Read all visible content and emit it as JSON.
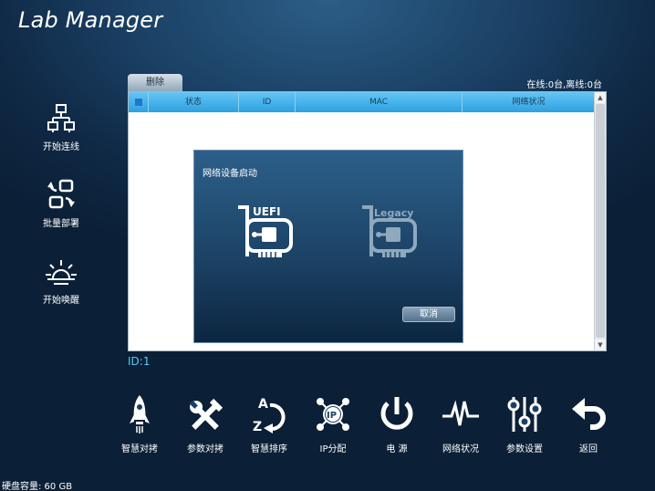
{
  "app": {
    "title": "Lab Manager"
  },
  "sidebar": {
    "items": [
      {
        "label": "开始连线",
        "icon": "network-icon"
      },
      {
        "label": "批量部署",
        "icon": "deploy-icon"
      },
      {
        "label": "开始唤醒",
        "icon": "sunrise-icon"
      }
    ]
  },
  "table": {
    "delete_label": "删除",
    "online_status": "在线:0台,离线:0台",
    "columns": [
      "状态",
      "ID",
      "MAC",
      "网络状况"
    ],
    "rows": []
  },
  "dialog": {
    "title": "网络设备启动",
    "options": [
      {
        "label": "UEFI",
        "icon": "uefi-card-icon",
        "state": "active"
      },
      {
        "label": "Legacy",
        "icon": "legacy-card-icon",
        "state": "dimmed"
      }
    ],
    "cancel_label": "取消"
  },
  "id_label": "ID:1",
  "toolbar": {
    "items": [
      {
        "label": "智慧对拷",
        "icon": "rocket-icon"
      },
      {
        "label": "参数对拷",
        "icon": "tools-icon"
      },
      {
        "label": "智慧排序",
        "icon": "sort-az-icon"
      },
      {
        "label": "IP分配",
        "icon": "ip-icon"
      },
      {
        "label": "电 源",
        "icon": "power-icon"
      },
      {
        "label": "网络状况",
        "icon": "pulse-icon"
      },
      {
        "label": "参数设置",
        "icon": "sliders-icon"
      },
      {
        "label": "返回",
        "icon": "back-arrow-icon"
      }
    ]
  },
  "disk_info": "硬盘容量: 60 GB",
  "colors": {
    "accent": "#5ec6f4",
    "table_header": "#3fb0ea"
  }
}
